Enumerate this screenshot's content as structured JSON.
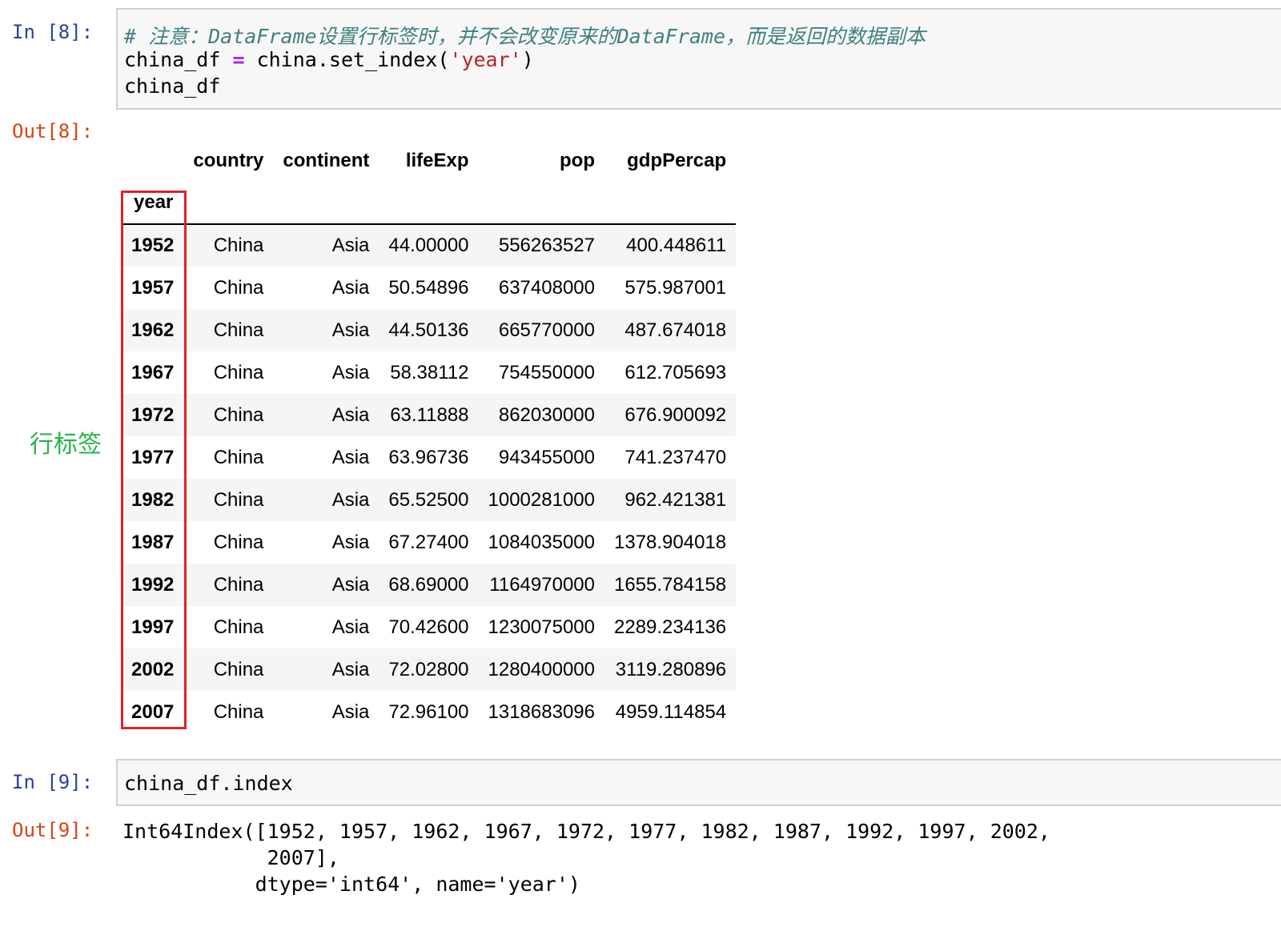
{
  "cell8": {
    "in_prompt": "In [8]:",
    "code_comment": "# 注意：DataFrame设置行标签时，并不会改变原来的DataFrame，而是返回的数据副本",
    "code_line2_left": "china_df ",
    "code_line2_op": "=",
    "code_line2_mid": " china.set_index(",
    "code_line2_str": "'year'",
    "code_line2_end": ")",
    "code_line3": "china_df",
    "out_prompt": "Out[8]:"
  },
  "table": {
    "columns": [
      "country",
      "continent",
      "lifeExp",
      "pop",
      "gdpPercap"
    ],
    "index_name": "year",
    "rows": [
      {
        "year": "1952",
        "country": "China",
        "continent": "Asia",
        "lifeExp": "44.00000",
        "pop": "556263527",
        "gdpPercap": "400.448611"
      },
      {
        "year": "1957",
        "country": "China",
        "continent": "Asia",
        "lifeExp": "50.54896",
        "pop": "637408000",
        "gdpPercap": "575.987001"
      },
      {
        "year": "1962",
        "country": "China",
        "continent": "Asia",
        "lifeExp": "44.50136",
        "pop": "665770000",
        "gdpPercap": "487.674018"
      },
      {
        "year": "1967",
        "country": "China",
        "continent": "Asia",
        "lifeExp": "58.38112",
        "pop": "754550000",
        "gdpPercap": "612.705693"
      },
      {
        "year": "1972",
        "country": "China",
        "continent": "Asia",
        "lifeExp": "63.11888",
        "pop": "862030000",
        "gdpPercap": "676.900092"
      },
      {
        "year": "1977",
        "country": "China",
        "continent": "Asia",
        "lifeExp": "63.96736",
        "pop": "943455000",
        "gdpPercap": "741.237470"
      },
      {
        "year": "1982",
        "country": "China",
        "continent": "Asia",
        "lifeExp": "65.52500",
        "pop": "1000281000",
        "gdpPercap": "962.421381"
      },
      {
        "year": "1987",
        "country": "China",
        "continent": "Asia",
        "lifeExp": "67.27400",
        "pop": "1084035000",
        "gdpPercap": "1378.904018"
      },
      {
        "year": "1992",
        "country": "China",
        "continent": "Asia",
        "lifeExp": "68.69000",
        "pop": "1164970000",
        "gdpPercap": "1655.784158"
      },
      {
        "year": "1997",
        "country": "China",
        "continent": "Asia",
        "lifeExp": "70.42600",
        "pop": "1230075000",
        "gdpPercap": "2289.234136"
      },
      {
        "year": "2002",
        "country": "China",
        "continent": "Asia",
        "lifeExp": "72.02800",
        "pop": "1280400000",
        "gdpPercap": "3119.280896"
      },
      {
        "year": "2007",
        "country": "China",
        "continent": "Asia",
        "lifeExp": "72.96100",
        "pop": "1318683096",
        "gdpPercap": "4959.114854"
      }
    ]
  },
  "annotation": {
    "label": "行标签",
    "color": "#2bb34a",
    "box_color": "#e0212b"
  },
  "cell9": {
    "in_prompt": "In [9]:",
    "code": "china_df.index",
    "out_prompt": "Out[9]:",
    "output_lines": [
      "Int64Index([1952, 1957, 1962, 1967, 1972, 1977, 1982, 1987, 1992, 1997, 2002,",
      "            2007],",
      "           dtype='int64', name='year')"
    ]
  }
}
